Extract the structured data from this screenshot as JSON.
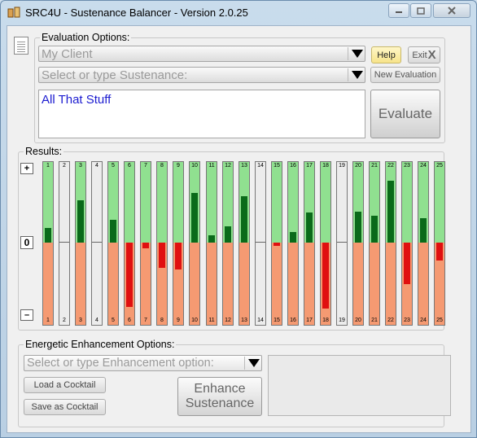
{
  "window": {
    "title": "SRC4U - Sustenance Balancer - Version 2.0.25"
  },
  "evaluation": {
    "group_label": "Evaluation Options:",
    "client_value": "My Client",
    "sustenance_placeholder": "Select or type Sustenance:",
    "notes_text": "All That Stuff",
    "help_label": "Help",
    "exit_label": "Exit",
    "new_evaluation_label": "New Evaluation",
    "evaluate_label": "Evaluate"
  },
  "results": {
    "group_label": "Results:",
    "plus_label": "+",
    "zero_label": "0",
    "minus_label": "–",
    "colors": {
      "positive_bg": "#90e090",
      "negative_bg": "#f59a72",
      "positive_fill": "#0a6a1a",
      "negative_fill": "#e01010",
      "blank_bg": "#ececec"
    },
    "bars": [
      {
        "n": "1",
        "value": 0.18
      },
      {
        "n": "2",
        "value": 0,
        "blank": true
      },
      {
        "n": "3",
        "value": 0.53
      },
      {
        "n": "4",
        "value": 0,
        "blank": true
      },
      {
        "n": "5",
        "value": 0.28
      },
      {
        "n": "6",
        "value": -0.78
      },
      {
        "n": "7",
        "value": -0.07
      },
      {
        "n": "8",
        "value": -0.31
      },
      {
        "n": "9",
        "value": -0.33
      },
      {
        "n": "10",
        "value": 0.62
      },
      {
        "n": "11",
        "value": 0.09
      },
      {
        "n": "12",
        "value": 0.2
      },
      {
        "n": "13",
        "value": 0.58
      },
      {
        "n": "14",
        "value": 0,
        "blank": true
      },
      {
        "n": "15",
        "value": -0.04
      },
      {
        "n": "16",
        "value": 0.13
      },
      {
        "n": "17",
        "value": 0.37
      },
      {
        "n": "18",
        "value": -0.8
      },
      {
        "n": "19",
        "value": 0,
        "blank": true
      },
      {
        "n": "20",
        "value": 0.38
      },
      {
        "n": "21",
        "value": 0.33
      },
      {
        "n": "22",
        "value": 0.77
      },
      {
        "n": "23",
        "value": -0.5
      },
      {
        "n": "24",
        "value": 0.3
      },
      {
        "n": "25",
        "value": -0.22
      }
    ]
  },
  "enhancement": {
    "group_label": "Energetic Enhancement Options:",
    "option_placeholder": "Select or type Enhancement option:",
    "load_label": "Load a Cocktail",
    "save_label": "Save as Cocktail",
    "enhance_line1": "Enhance",
    "enhance_line2": "Sustenance"
  },
  "icons": [
    "app-icon",
    "minimize-icon",
    "maximize-icon",
    "close-icon",
    "notepad-icon",
    "dropdown-arrow-icon",
    "exit-x-icon"
  ]
}
